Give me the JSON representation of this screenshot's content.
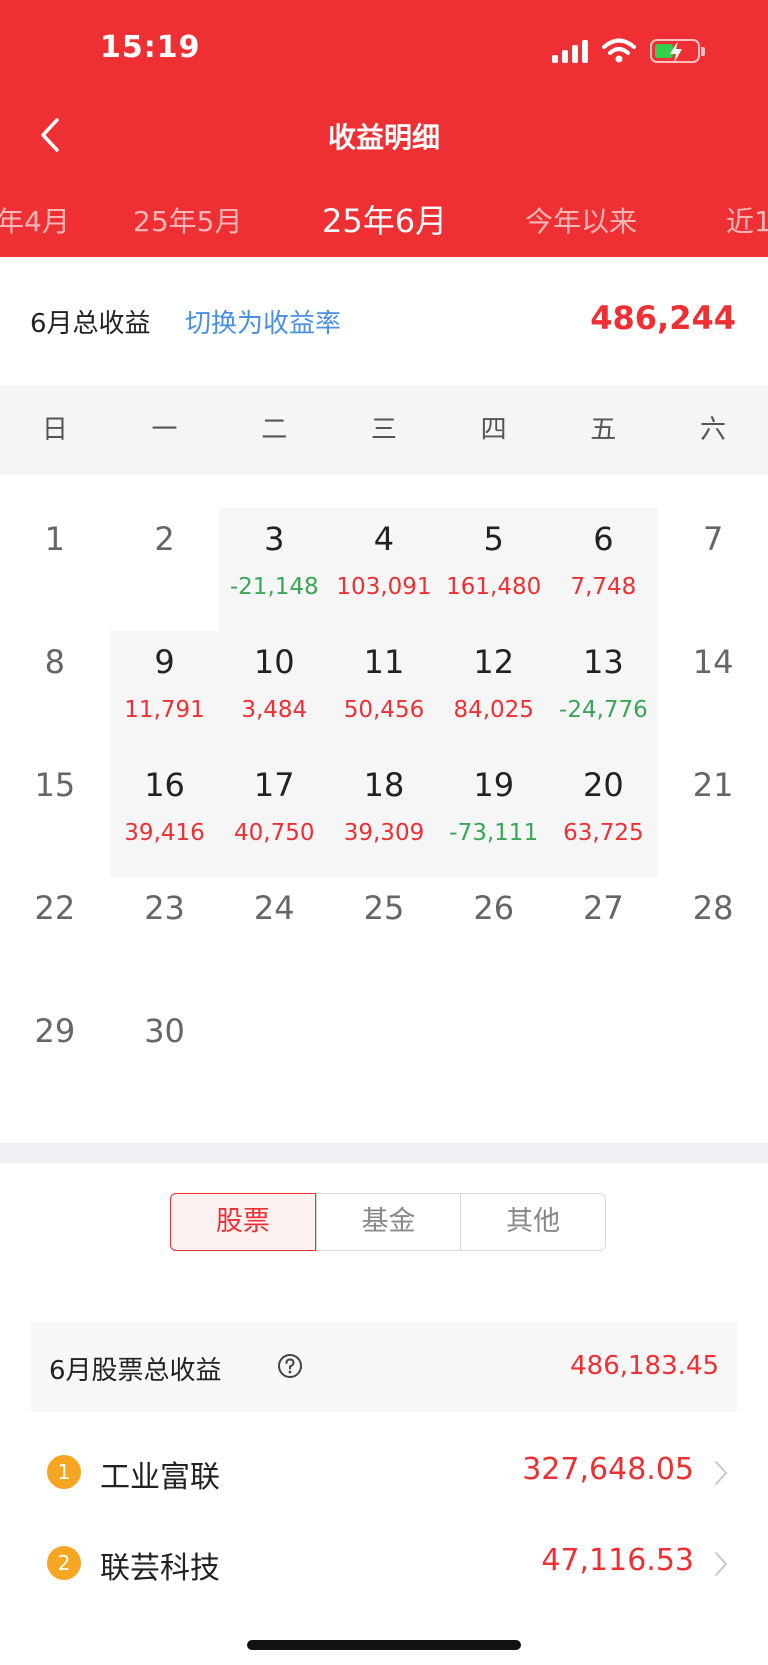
{
  "status": {
    "time": "15:19"
  },
  "header": {
    "title": "收益明细",
    "month_tabs": [
      {
        "label": "年4月",
        "active": false
      },
      {
        "label": "25年5月",
        "active": false
      },
      {
        "label": "25年6月",
        "active": true
      },
      {
        "label": "今年以来",
        "active": false
      },
      {
        "label": "近1",
        "active": false
      }
    ]
  },
  "summary": {
    "label": "6月总收益",
    "switch_label": "切换为收益率",
    "value": "486,244"
  },
  "weekdays": [
    "日",
    "一",
    "二",
    "三",
    "四",
    "五",
    "六"
  ],
  "calendar": {
    "days": [
      {
        "day": "1",
        "value": ""
      },
      {
        "day": "2",
        "value": ""
      },
      {
        "day": "3",
        "value": "-21,148"
      },
      {
        "day": "4",
        "value": "103,091"
      },
      {
        "day": "5",
        "value": "161,480"
      },
      {
        "day": "6",
        "value": "7,748"
      },
      {
        "day": "7",
        "value": ""
      },
      {
        "day": "8",
        "value": ""
      },
      {
        "day": "9",
        "value": "11,791"
      },
      {
        "day": "10",
        "value": "3,484"
      },
      {
        "day": "11",
        "value": "50,456"
      },
      {
        "day": "12",
        "value": "84,025"
      },
      {
        "day": "13",
        "value": "-24,776"
      },
      {
        "day": "14",
        "value": ""
      },
      {
        "day": "15",
        "value": ""
      },
      {
        "day": "16",
        "value": "39,416"
      },
      {
        "day": "17",
        "value": "40,750"
      },
      {
        "day": "18",
        "value": "39,309"
      },
      {
        "day": "19",
        "value": "-73,111"
      },
      {
        "day": "20",
        "value": "63,725"
      },
      {
        "day": "21",
        "value": ""
      },
      {
        "day": "22",
        "value": ""
      },
      {
        "day": "23",
        "value": ""
      },
      {
        "day": "24",
        "value": ""
      },
      {
        "day": "25",
        "value": ""
      },
      {
        "day": "26",
        "value": ""
      },
      {
        "day": "27",
        "value": ""
      },
      {
        "day": "28",
        "value": ""
      },
      {
        "day": "29",
        "value": ""
      },
      {
        "day": "30",
        "value": ""
      }
    ]
  },
  "segments": [
    {
      "label": "股票",
      "active": true
    },
    {
      "label": "基金",
      "active": false
    },
    {
      "label": "其他",
      "active": false
    }
  ],
  "stock_summary": {
    "label": "6月股票总收益",
    "value": "486,183.45"
  },
  "stocks": [
    {
      "rank": "1",
      "name": "工业富联",
      "value": "327,648.05"
    },
    {
      "rank": "2",
      "name": "联芸科技",
      "value": "47,116.53"
    }
  ],
  "colors": {
    "accent": "#ee2f33",
    "positive": "#ee2f33",
    "negative": "#3aa657",
    "link": "#4a90e2",
    "rank": "#f6a623"
  }
}
